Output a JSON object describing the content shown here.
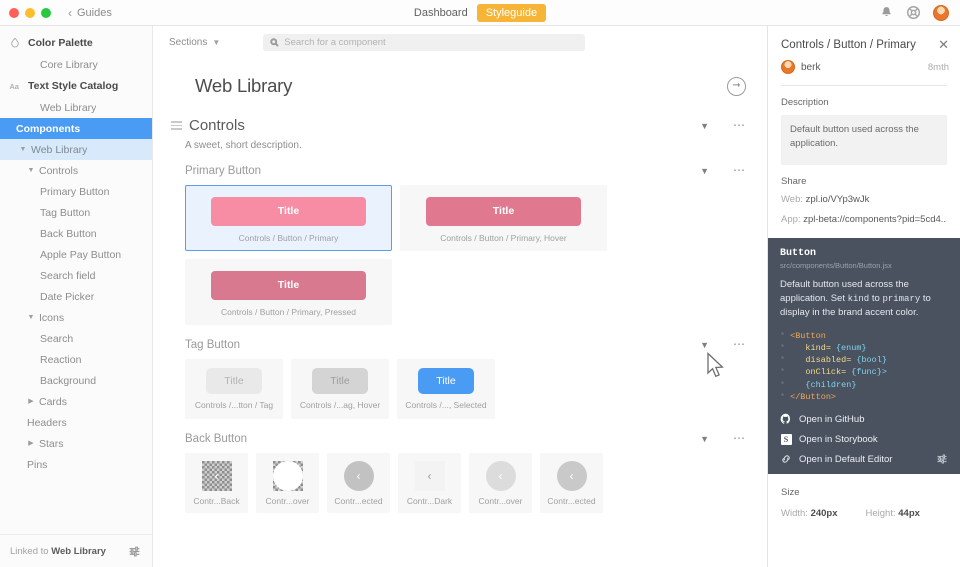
{
  "titlebar": {
    "back_label": "Guides",
    "center_link": "Dashboard",
    "center_pill": "Styleguide",
    "icons": [
      "bell-icon",
      "help-ring-icon",
      "user-avatar"
    ]
  },
  "sidebar": {
    "items": [
      {
        "label": "Color Palette",
        "level": 0,
        "icon": "droplet-icon",
        "state": "group"
      },
      {
        "label": "Core Library",
        "level": 3,
        "state": "plain"
      },
      {
        "label": "Text Style Catalog",
        "level": 0,
        "icon": "aa-icon",
        "state": "group"
      },
      {
        "label": "Web Library",
        "level": 3,
        "state": "plain"
      },
      {
        "label": "Components",
        "level": 0,
        "icon": "grid-icon",
        "state": "selected"
      },
      {
        "label": "Web Library",
        "level": 1,
        "state": "active",
        "twisty": "down"
      },
      {
        "label": "Controls",
        "level": 2,
        "state": "plain",
        "twisty": "down"
      },
      {
        "label": "Primary Button",
        "level": 3,
        "state": "plain"
      },
      {
        "label": "Tag Button",
        "level": 3,
        "state": "plain"
      },
      {
        "label": "Back Button",
        "level": 3,
        "state": "plain"
      },
      {
        "label": "Apple Pay Button",
        "level": 3,
        "state": "plain"
      },
      {
        "label": "Search field",
        "level": 3,
        "state": "plain"
      },
      {
        "label": "Date Picker",
        "level": 3,
        "state": "plain"
      },
      {
        "label": "Icons",
        "level": 2,
        "state": "plain",
        "twisty": "down"
      },
      {
        "label": "Search",
        "level": 3,
        "state": "plain"
      },
      {
        "label": "Reaction",
        "level": 3,
        "state": "plain"
      },
      {
        "label": "Background",
        "level": 3,
        "state": "plain"
      },
      {
        "label": "Cards",
        "level": 2,
        "state": "plain",
        "twisty": "right"
      },
      {
        "label": "Headers",
        "level": 2,
        "state": "plain"
      },
      {
        "label": "Stars",
        "level": 2,
        "state": "plain",
        "twisty": "right"
      },
      {
        "label": "Pins",
        "level": 2,
        "state": "plain"
      }
    ],
    "footer": {
      "prefix": "Linked to",
      "link_name": "Web Library",
      "settings_icon": "sliders-icon"
    }
  },
  "center": {
    "sections_label": "Sections",
    "search": {
      "placeholder": "Search for a component",
      "value": "",
      "icon": "search-icon"
    },
    "page_title": "Web Library",
    "page_action_icon": "arrow-right-circle-icon",
    "section": {
      "title": "Controls",
      "description": "A sweet, short description.",
      "handle_icon": "drag-handle-icon",
      "caret_icon": "caret-down-icon",
      "menu_icon": "ellipsis-icon"
    },
    "groups": [
      {
        "title": "Primary Button",
        "kind": "primary",
        "cards": [
          {
            "caption": "Controls / Button / Primary",
            "label": "Title",
            "color": "#f78da4",
            "selected": true
          },
          {
            "caption": "Controls / Button / Primary, Hover",
            "label": "Title",
            "color": "#e0798f",
            "selected": false
          },
          {
            "caption": "Controls / Button / Primary, Pressed",
            "label": "Title",
            "color": "#d97990",
            "selected": false
          }
        ]
      },
      {
        "title": "Tag Button",
        "kind": "tag",
        "cards": [
          {
            "caption": "Controls /...tton / Tag",
            "label": "Title",
            "color": "#e9e9e9",
            "text_color": "#b4b4b4",
            "selected": false
          },
          {
            "caption": "Controls /...ag, Hover",
            "label": "Title",
            "color": "#d4d4d4",
            "text_color": "#9f9f9f",
            "selected": false
          },
          {
            "caption": "Controls /..., Selected",
            "label": "Title",
            "color": "#4a9bf4",
            "text_color": "#ffffff",
            "selected": false
          }
        ]
      },
      {
        "title": "Back Button",
        "kind": "back",
        "cards": [
          {
            "caption": "Contr...Back",
            "style": "checker",
            "chevron_color": "#ffffff"
          },
          {
            "caption": "Contr...over",
            "style": "checker-ring",
            "chevron_color": "#ffffff"
          },
          {
            "caption": "Contr...ected",
            "style": "solid",
            "bg": "#c2c2c2",
            "chevron_color": "#ffffff"
          },
          {
            "caption": "Contr...Dark",
            "style": "flat",
            "bg": "#f3f3f3",
            "chevron_color": "#9a9a9a"
          },
          {
            "caption": "Contr...over",
            "style": "solid",
            "bg": "#dcdcdc",
            "chevron_color": "#ffffff"
          },
          {
            "caption": "Contr...ected",
            "style": "solid",
            "bg": "#c9c9c9",
            "chevron_color": "#ffffff"
          }
        ]
      }
    ]
  },
  "inspector": {
    "title": "Controls / Button / Primary",
    "close_icon": "close-icon",
    "author": {
      "name": "berk",
      "time": "8mth",
      "avatar": "user-avatar"
    },
    "description_label": "Description",
    "description_text": "Default button used across the application.",
    "share_label": "Share",
    "share": [
      {
        "key": "Web:",
        "value": "zpl.io/VYp3wJk"
      },
      {
        "key": "App:",
        "value": "zpl-beta://components?pid=5cd4..."
      }
    ],
    "code": {
      "component_name": "Button",
      "path": "src/components/Button/Button.jsx",
      "desc_line1": "Default button used across the",
      "desc_line2": "application.",
      "desc_set": "Set",
      "desc_kind": "kind",
      "desc_to": "to",
      "desc_primary": "primary",
      "desc_tail": "to display in the",
      "desc_line4": "brand accent color.",
      "snippet": [
        {
          "bullet": "*",
          "parts": [
            {
              "t": "<Button",
              "c": "#f0a657"
            }
          ]
        },
        {
          "bullet": "*",
          "parts": [
            {
              "t": "   kind=",
              "c": "#f2d98c"
            },
            {
              "t": "{enum}",
              "c": "#7fd4e8"
            }
          ]
        },
        {
          "bullet": "*",
          "parts": [
            {
              "t": "   disabled=",
              "c": "#f2d98c"
            },
            {
              "t": "{bool}",
              "c": "#7fd4e8"
            }
          ]
        },
        {
          "bullet": "*",
          "parts": [
            {
              "t": "   onClick=",
              "c": "#f2d98c"
            },
            {
              "t": "{func}>",
              "c": "#7fd4e8"
            }
          ]
        },
        {
          "bullet": "*",
          "parts": [
            {
              "t": "   {children}",
              "c": "#7fd4e8"
            }
          ]
        },
        {
          "bullet": "*",
          "parts": [
            {
              "t": "</Button>",
              "c": "#f0a657"
            }
          ]
        }
      ],
      "links": [
        {
          "label": "Open in GitHub",
          "icon": "github-icon"
        },
        {
          "label": "Open in Storybook",
          "icon": "storybook-icon"
        },
        {
          "label": "Open in Default Editor",
          "icon": "link-icon",
          "trailing_icon": "sliders-icon"
        }
      ]
    },
    "size": {
      "label": "Size",
      "width_key": "Width:",
      "width_value": "240px",
      "height_key": "Height:",
      "height_value": "44px"
    }
  },
  "colors": {
    "accent_blue": "#4a9bf4",
    "pill_amber": "#f7b538",
    "pink_primary": "#f78da4",
    "code_bg": "#4a5260"
  }
}
